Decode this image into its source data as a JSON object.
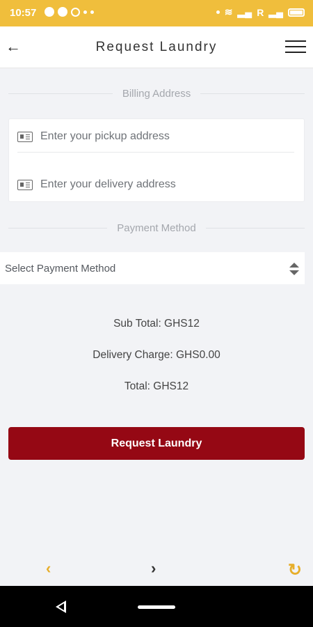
{
  "status_bar": {
    "time": "10:57",
    "carrier_mark": "R"
  },
  "header": {
    "title": "Request Laundry",
    "back_icon": "←"
  },
  "billing": {
    "section_title": "Billing Address",
    "pickup_placeholder": "Enter your pickup address",
    "pickup_value": "",
    "delivery_placeholder": "Enter your delivery address",
    "delivery_value": ""
  },
  "payment": {
    "section_title": "Payment Method",
    "select_label": "Select Payment Method"
  },
  "totals": {
    "sub_total": "Sub Total: GHS12",
    "delivery_charge": "Delivery Charge: GHS0.00",
    "total": "Total: GHS12"
  },
  "actions": {
    "request_label": "Request Laundry"
  },
  "bottom_nav": {
    "prev_icon": "‹",
    "next_icon": "›",
    "reload_icon": "↻"
  },
  "colors": {
    "status_bar": "#f0be3c",
    "primary_button": "#950814",
    "nav_accent": "#e7ae2a",
    "background": "#f2f3f6"
  }
}
